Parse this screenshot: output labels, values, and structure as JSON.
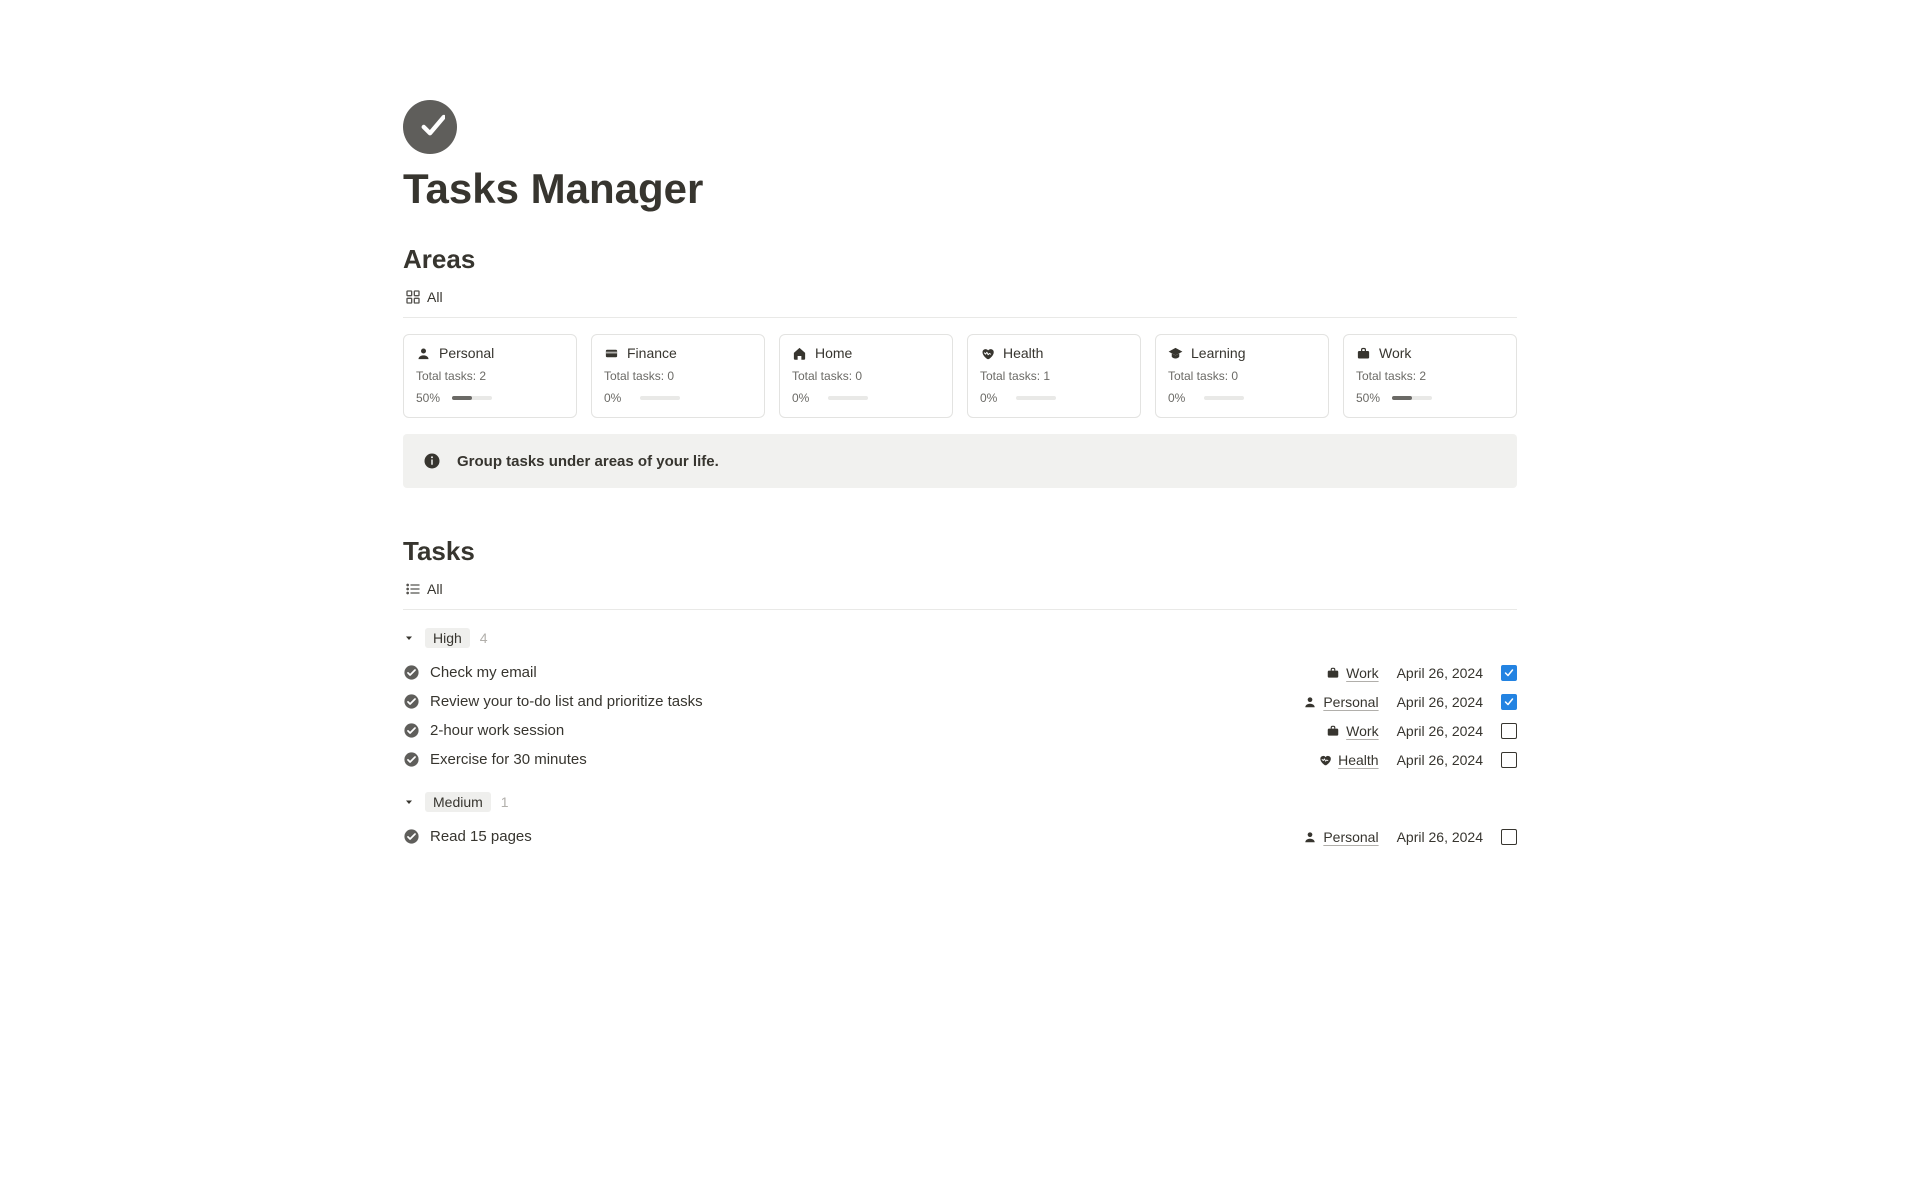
{
  "page": {
    "title": "Tasks Manager"
  },
  "areas_section": {
    "heading": "Areas",
    "view_tab": "All",
    "callout": "Group tasks under areas of your life.",
    "cards": [
      {
        "icon": "person",
        "name": "Personal",
        "total_prefix": "Total tasks: ",
        "total": 2,
        "percent": "50%",
        "fill": 50
      },
      {
        "icon": "card",
        "name": "Finance",
        "total_prefix": "Total tasks: ",
        "total": 0,
        "percent": "0%",
        "fill": 0
      },
      {
        "icon": "home",
        "name": "Home",
        "total_prefix": "Total tasks: ",
        "total": 0,
        "percent": "0%",
        "fill": 0
      },
      {
        "icon": "heart",
        "name": "Health",
        "total_prefix": "Total tasks: ",
        "total": 1,
        "percent": "0%",
        "fill": 0
      },
      {
        "icon": "grad",
        "name": "Learning",
        "total_prefix": "Total tasks: ",
        "total": 0,
        "percent": "0%",
        "fill": 0
      },
      {
        "icon": "brief",
        "name": "Work",
        "total_prefix": "Total tasks: ",
        "total": 2,
        "percent": "50%",
        "fill": 50
      }
    ]
  },
  "tasks_section": {
    "heading": "Tasks",
    "view_tab": "All",
    "groups": [
      {
        "name": "High",
        "count": 4,
        "tasks": [
          {
            "title": "Check my email",
            "area_icon": "brief",
            "area": "Work",
            "date": "April 26, 2024",
            "done": true
          },
          {
            "title": "Review your to-do list and prioritize tasks",
            "area_icon": "person",
            "area": "Personal",
            "date": "April 26, 2024",
            "done": true
          },
          {
            "title": "2-hour work session",
            "area_icon": "brief",
            "area": "Work",
            "date": "April 26, 2024",
            "done": false
          },
          {
            "title": "Exercise for 30 minutes",
            "area_icon": "heart",
            "area": "Health",
            "date": "April 26, 2024",
            "done": false
          }
        ]
      },
      {
        "name": "Medium",
        "count": 1,
        "tasks": [
          {
            "title": "Read 15 pages",
            "area_icon": "person",
            "area": "Personal",
            "date": "April 26, 2024",
            "done": false
          }
        ]
      }
    ]
  }
}
